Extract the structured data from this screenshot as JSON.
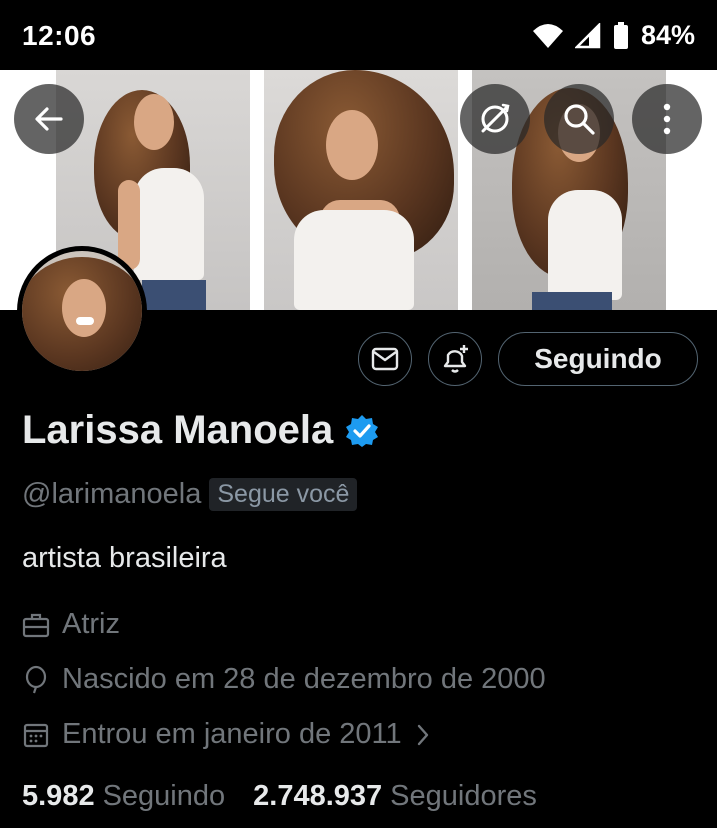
{
  "status_bar": {
    "time": "12:06",
    "battery": "84%"
  },
  "header": {
    "back_icon": "arrow-left-icon",
    "translate_icon": "no-translate-icon",
    "search_icon": "search-icon",
    "more_icon": "more-vertical-icon"
  },
  "profile": {
    "name": "Larissa Manoela",
    "verified": true,
    "handle": "@larimanoela",
    "follows_you": "Segue você",
    "bio": "artista brasileira",
    "category": "Atriz",
    "birth": "Nascido em 28 de dezembro de 2000",
    "joined": "Entrou em janeiro de 2011",
    "following_count": "5.982",
    "following_label": "Seguindo",
    "followers_count": "2.748.937",
    "followers_label": "Seguidores"
  },
  "actions": {
    "follow_label": "Seguindo"
  },
  "colors": {
    "accent": "#1d9bf0",
    "muted": "#71767b",
    "text": "#e7e9ea",
    "border": "#536471"
  }
}
